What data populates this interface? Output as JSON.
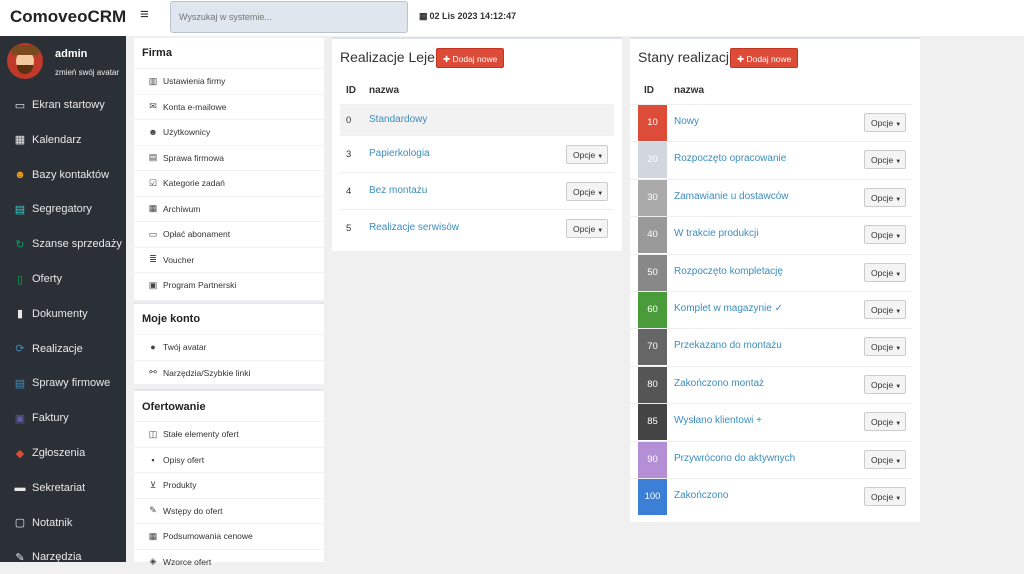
{
  "app": {
    "brand": "ComoveoCRM",
    "search_placeholder": "Wyszukaj w systemie...",
    "datetime": "02 Lis 2023 14:12:47"
  },
  "user": {
    "name": "admin",
    "change_avatar": "zmień swój avatar"
  },
  "sidebar": {
    "items": [
      {
        "label": "Ekran startowy",
        "icon": "monitor-icon",
        "color": "#e8e8e8"
      },
      {
        "label": "Kalendarz",
        "icon": "calendar-icon",
        "color": "#e8e8e8"
      },
      {
        "label": "Bazy kontaktów",
        "icon": "users-icon",
        "color": "#f39c12"
      },
      {
        "label": "Segregatory",
        "icon": "briefcase-icon",
        "color": "#39cccc"
      },
      {
        "label": "Szanse sprzedaży",
        "icon": "refresh-icon",
        "color": "#00a65a"
      },
      {
        "label": "Oferty",
        "icon": "file-icon",
        "color": "#00a65a"
      },
      {
        "label": "Dokumenty",
        "icon": "document-icon",
        "color": "#e8e8e8"
      },
      {
        "label": "Realizacje",
        "icon": "sync-icon",
        "color": "#3c8dbc"
      },
      {
        "label": "Sprawy firmowe",
        "icon": "briefcase-icon",
        "color": "#3c8dbc"
      },
      {
        "label": "Faktury",
        "icon": "invoice-icon",
        "color": "#605ca8"
      },
      {
        "label": "Zgłoszenia",
        "icon": "ticket-icon",
        "color": "#dd4b39"
      },
      {
        "label": "Sekretariat",
        "icon": "inbox-icon",
        "color": "#e8e8e8"
      },
      {
        "label": "Notatnik",
        "icon": "note-icon",
        "color": "#e8e8e8"
      },
      {
        "label": "Narzędzia",
        "icon": "wrench-icon",
        "color": "#e8e8e8"
      }
    ]
  },
  "firma": {
    "title": "Firma",
    "items": [
      {
        "label": "Ustawienia firmy",
        "icon": "building-icon"
      },
      {
        "label": "Konta e-mailowe",
        "icon": "envelope-icon"
      },
      {
        "label": "Użytkownicy",
        "icon": "users-icon"
      },
      {
        "label": "Sprawa firmowa",
        "icon": "briefcase-icon"
      },
      {
        "label": "Kategorie zadań",
        "icon": "checkbox-icon"
      },
      {
        "label": "Archiwum",
        "icon": "archive-icon"
      },
      {
        "label": "Opłać abonament",
        "icon": "credit-card-icon"
      },
      {
        "label": "Voucher",
        "icon": "barcode-icon"
      },
      {
        "label": "Program Partnerski",
        "icon": "money-icon"
      }
    ]
  },
  "moje_konto": {
    "title": "Moje konto",
    "items": [
      {
        "label": "Twój avatar",
        "icon": "user-icon"
      },
      {
        "label": "Narzędzia/Szybkie linki",
        "icon": "link-icon"
      }
    ]
  },
  "ofertowanie": {
    "title": "Ofertowanie",
    "items": [
      {
        "label": "Stałe elementy ofert",
        "icon": "map-icon"
      },
      {
        "label": "Opisy ofert",
        "icon": "save-icon"
      },
      {
        "label": "Produkty",
        "icon": "cart-icon"
      },
      {
        "label": "Wstępy do ofert",
        "icon": "pencil-icon"
      },
      {
        "label": "Podsumowania cenowe",
        "icon": "calculator-icon"
      },
      {
        "label": "Wzorce ofert",
        "icon": "cube-icon"
      }
    ]
  },
  "lejek": {
    "title": "Realizacje Lejek",
    "add_label": "Dodaj nowe",
    "col_id": "ID",
    "col_name": "nazwa",
    "options_label": "Opcje",
    "rows": [
      {
        "id": "0",
        "name": "Standardowy",
        "has_options": false
      },
      {
        "id": "3",
        "name": "Papierkologia",
        "has_options": true
      },
      {
        "id": "4",
        "name": "Bez montażu",
        "has_options": true
      },
      {
        "id": "5",
        "name": "Realizacje serwisów",
        "has_options": true
      }
    ]
  },
  "stany": {
    "title": "Stany realizacji",
    "add_label": "Dodaj nowe",
    "col_id": "ID",
    "col_name": "nazwa",
    "options_label": "Opcje",
    "rows": [
      {
        "id": "10",
        "name": "Nowy",
        "color": "#dd4b39"
      },
      {
        "id": "20",
        "name": "Rozpoczęto opracowanie",
        "color": "#d2d6de"
      },
      {
        "id": "30",
        "name": "Zamawianie u dostawców",
        "color": "#aaaaaa"
      },
      {
        "id": "40",
        "name": "W trakcie produkcji",
        "color": "#999999"
      },
      {
        "id": "50",
        "name": "Rozpoczęto kompletację",
        "color": "#888888"
      },
      {
        "id": "60",
        "name": "Komplet w magazynie ✓",
        "color": "#4a9c3a"
      },
      {
        "id": "70",
        "name": "Przekazano do montażu",
        "color": "#666666"
      },
      {
        "id": "80",
        "name": "Zakończono montaż",
        "color": "#555555"
      },
      {
        "id": "85",
        "name": "Wysłano klientowi +",
        "color": "#444444"
      },
      {
        "id": "90",
        "name": "Przywrócono do aktywnych",
        "color": "#b48fd6"
      },
      {
        "id": "100",
        "name": "Zakończono",
        "color": "#3c7fd6"
      }
    ]
  }
}
